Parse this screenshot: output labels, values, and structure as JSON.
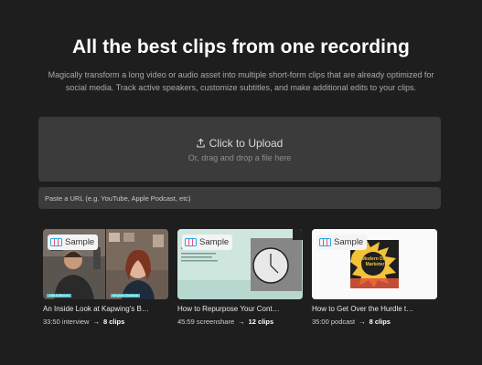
{
  "hero": {
    "title": "All the best clips from one recording",
    "subtitle": "Magically transform a long video or audio asset into multiple short-form clips that are already optimized for social media. Track active speakers, customize subtitles, and make additional edits to your clips."
  },
  "upload": {
    "label": "Click to Upload",
    "hint": "Or, drag and drop a file here",
    "icon": "upload-icon"
  },
  "url_input": {
    "placeholder": "Paste a URL (e.g. YouTube, Apple Podcast, etc)",
    "value": ""
  },
  "samples": [
    {
      "badge": "Sample",
      "title": "An Inside Look at Kapwing's B…",
      "meta": "33:50 interview",
      "clips": "8 clips",
      "thumb_left_caption": "Julia Enthoven",
      "thumb_right_caption": "Meghan Crawford"
    },
    {
      "badge": "Sample",
      "title": "How to Repurpose Your Cont…",
      "meta": "45:59 screenshare",
      "clips": "12 clips"
    },
    {
      "badge": "Sample",
      "title": "How to Get Over the Hurdle t…",
      "meta": "35:00 podcast",
      "clips": "8 clips",
      "thumb_cover_text": "Modern Day Marketer"
    }
  ],
  "colors": {
    "background": "#1e1e1e",
    "panel": "#3b3b3b",
    "badge_icon": "#29a8e0"
  },
  "arrow_glyph": "→"
}
